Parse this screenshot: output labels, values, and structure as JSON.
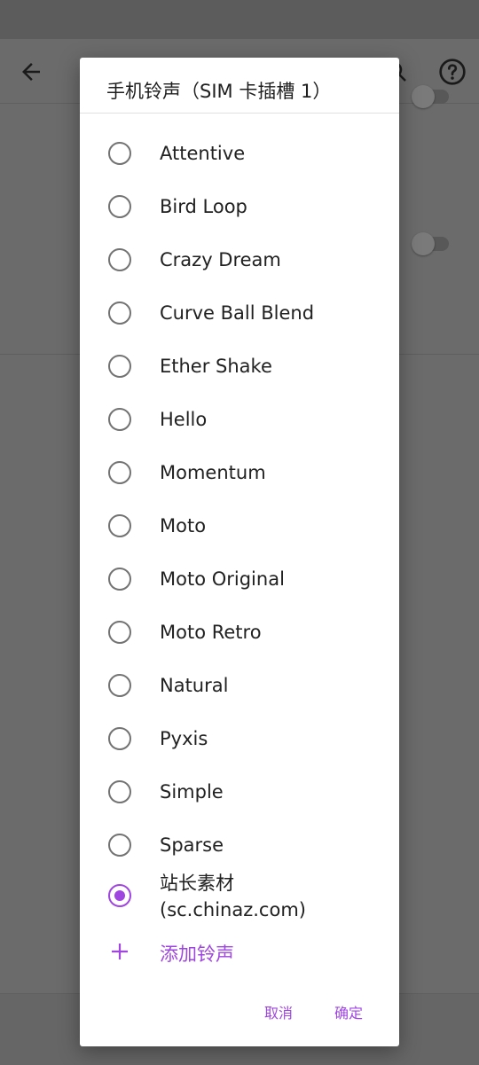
{
  "dialog": {
    "title": "手机铃声（SIM 卡插槽 1）",
    "options": [
      {
        "label": "Attentive",
        "selected": false
      },
      {
        "label": "Bird Loop",
        "selected": false
      },
      {
        "label": "Crazy Dream",
        "selected": false
      },
      {
        "label": "Curve Ball Blend",
        "selected": false
      },
      {
        "label": "Ether Shake",
        "selected": false
      },
      {
        "label": "Hello",
        "selected": false
      },
      {
        "label": "Momentum",
        "selected": false
      },
      {
        "label": "Moto",
        "selected": false
      },
      {
        "label": "Moto Original",
        "selected": false
      },
      {
        "label": "Moto Retro",
        "selected": false
      },
      {
        "label": "Natural",
        "selected": false
      },
      {
        "label": "Pyxis",
        "selected": false
      },
      {
        "label": "Simple",
        "selected": false
      },
      {
        "label": "Sparse",
        "selected": false
      },
      {
        "label": "站长素材\n(sc.chinaz.com)",
        "selected": true
      }
    ],
    "add_label": "添加铃声",
    "cancel_label": "取消",
    "ok_label": "确定"
  },
  "icons": {
    "back": "back-arrow-icon",
    "search": "search-icon",
    "help": "help-icon",
    "add": "plus-icon"
  },
  "colors": {
    "accent": "#9f46e0",
    "scrim": "#6b6b6b",
    "dialog_bg": "#ffffff"
  }
}
